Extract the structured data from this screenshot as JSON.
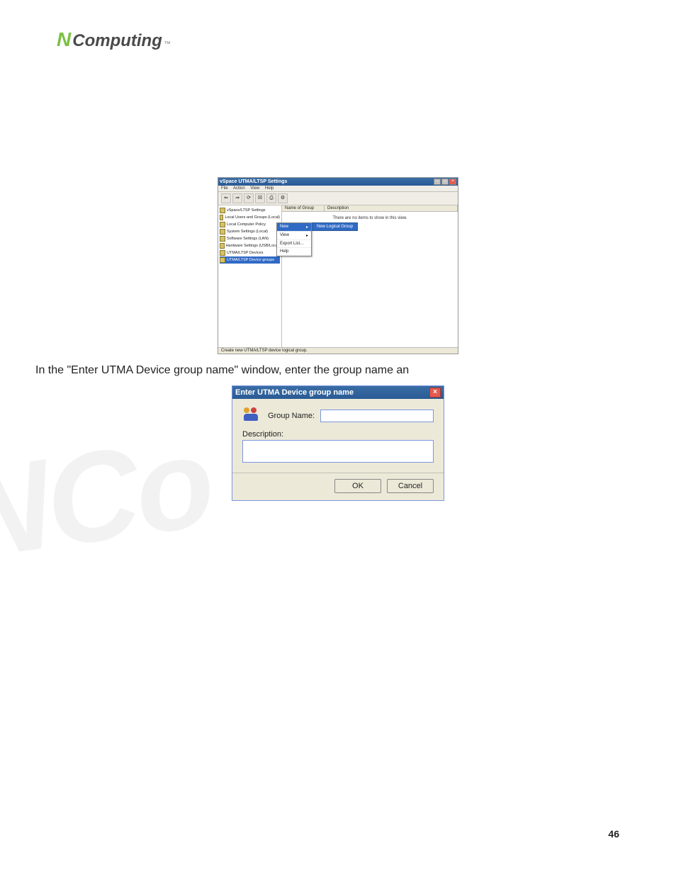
{
  "logo": {
    "n": "N",
    "text": "Computing",
    "tm": "™"
  },
  "screenshot_a": {
    "title": "vSpace UTMA/LTSP Settings",
    "menu": [
      "File",
      "Action",
      "View",
      "Help"
    ],
    "toolbar_glyphs": [
      "⇐",
      "⇒",
      "⟳",
      "☒",
      "⎙",
      "⚙"
    ],
    "tree": [
      "vSpace/LTSP Settings",
      "Local Users and Groups (Local)",
      "Local Computer Policy",
      "System Settings (Local)",
      "Software Settings (LAN)",
      "Hardware Settings (USB/Local)",
      "UTMA/LTSP Devices",
      "UTMA/LTSP Device groups"
    ],
    "tree_selected_index": 7,
    "list_headers": [
      "Name of Group",
      "Description"
    ],
    "empty_message": "There are no items to show in this view.",
    "context_menu": [
      "New",
      "View",
      "Export List...",
      "Help"
    ],
    "sub_menu_label": "New Logical Group",
    "statusbar": "Create new UTMA/LTSP device logical group."
  },
  "body_text": "In the \"Enter UTMA Device group name\" window, enter the group name an",
  "screenshot_b": {
    "title": "Enter UTMA Device group name",
    "group_name_label": "Group Name:",
    "description_label": "Description:",
    "ok": "OK",
    "cancel": "Cancel"
  },
  "watermark": "NCo",
  "page_number": "46"
}
